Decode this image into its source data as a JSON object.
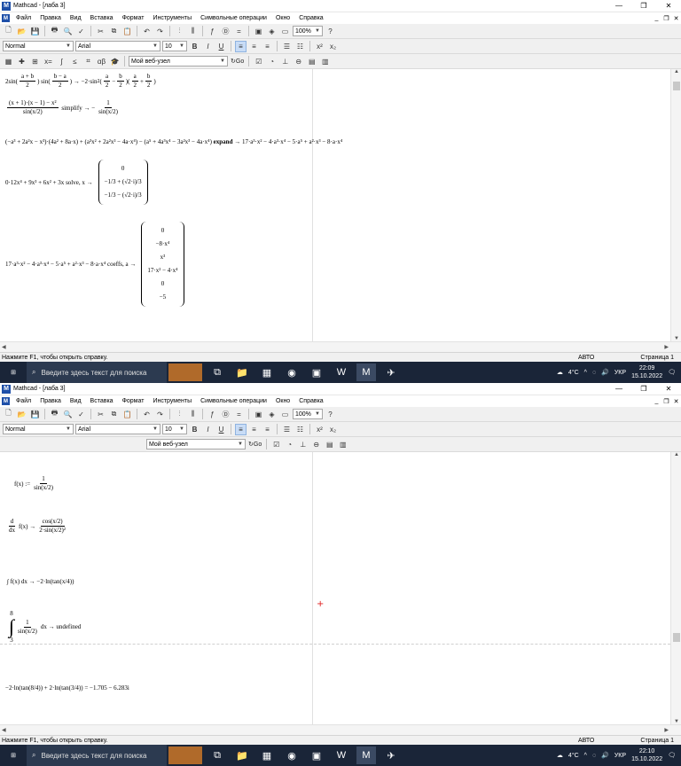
{
  "windows": [
    {
      "title": "Mathcad - [лаба 3]",
      "expressions": {
        "e1": {
          "a": "2sin",
          "b_num": "a + b",
          "b_den": "2",
          "c": "sin",
          "d_num": "b − a",
          "d_den": "2",
          "e": "→ −2·sin",
          "sup": "2",
          "f_num": "a",
          "f_den": "2",
          "g": "−",
          "h_num": "b",
          "h_den": "2",
          "i_num": "a",
          "i_den": "2",
          "j": "+",
          "k_num": "b",
          "k_den": "2"
        },
        "e2": {
          "num": "(x + 1)·(x − 1) − x²",
          "den": "sin(x/2)",
          "kw": "simplify",
          "arrow": "→",
          "rnum": "1",
          "rden": "sin(x/2)"
        },
        "e3": {
          "lhs": "(−a³ + 2a²x − x³)·(4a² + 8a·x) + (a³x² + 2a²x³ − 4a·x⁴) − (a⁵ + 4a³x⁴ − 3a²x³ − 4a·x⁴)",
          "kw": "expand",
          "rhs": "→ 17·a³·x² − 4·a³·x⁴ − 5·a⁵ + a²·x³ − 8·a·x⁴"
        },
        "e4": {
          "lhs": "0·12x⁴ + 9x³ + 6x² + 3x",
          "kw": "solve, x",
          "arrow": "→",
          "r1": "0",
          "r2": "−1/3 + (√2·i)/3",
          "r3": "−1/3 − (√2·i)/3"
        },
        "e5": {
          "lhs": "17·a³·x² − 4·a³·x⁴ − 5·a⁵ + a²·x³ − 8·a·x⁴",
          "kw": "coeffs, a",
          "arrow": "→",
          "r1": "0",
          "r2": "−8·x⁴",
          "r3": "x³",
          "r4": "17·x² − 4·x⁴",
          "r5": "0",
          "r6": "−5"
        }
      }
    },
    {
      "title": "Mathcad - [лаба 3]",
      "expressions": {
        "f1": {
          "lhs": "f(x) :=",
          "num": "1",
          "den": "sin(x/2)"
        },
        "f2": {
          "lhs_num": "d",
          "lhs_den": "dx",
          "lhs": "f(x) →",
          "num": "cos(x/2)",
          "den": "2·sin(x/2)²"
        },
        "f3": {
          "text": "∫ f(x) dx → −2·ln(tan(x/4))"
        },
        "f4": {
          "upper": "8",
          "lower": "3",
          "num": "1",
          "den": "sin(x/2)",
          "rest": "dx → undefined"
        },
        "f5": {
          "text": "−2·ln(tan(8/4)) + 2·ln(tan(3/4)) = −1.705 − 6.283i"
        }
      }
    }
  ],
  "menu": [
    "Файл",
    "Правка",
    "Вид",
    "Вставка",
    "Формат",
    "Инструменты",
    "Символьные операции",
    "Окно",
    "Справка"
  ],
  "app_logo": "M",
  "toolbar": {
    "style": "Normal",
    "font": "Arial",
    "size": "10",
    "bold": "B",
    "italic": "I",
    "underline": "U",
    "zoom": "100%",
    "help": "?"
  },
  "resources": {
    "combo": "Мой веб-узел",
    "go": "Go"
  },
  "status": {
    "help": "Нажмите F1, чтобы открыть справку.",
    "mode": "АВТО",
    "page": "Страница 1"
  },
  "taskbar": {
    "search_placeholder": "Введите здесь текст для поиска",
    "weather": "4°C",
    "lang": "УКР",
    "clocks": [
      {
        "time": "22:09",
        "date": "15.10.2022"
      },
      {
        "time": "22:10",
        "date": "15.10.2022"
      }
    ]
  },
  "colors": {
    "taskbar": "#1a2538",
    "logo": "#1e4fa8",
    "accent_red": "#e02020"
  }
}
